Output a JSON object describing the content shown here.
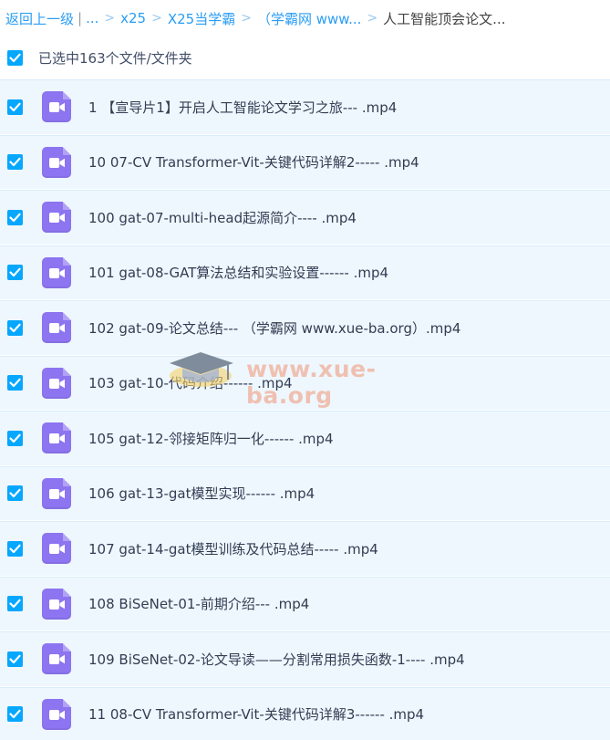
{
  "breadcrumb": {
    "back_label": "返回上一级",
    "divider": "|",
    "ellipsis": "...",
    "crumbs": [
      "x25",
      "X25当学霸",
      "（学霸网 www..."
    ],
    "current": "人工智能顶会论文..."
  },
  "selection": {
    "label": "已选中163个文件/文件夹"
  },
  "files": [
    {
      "name": "1 【宣导片1】开启人工智能论文学习之旅--- .mp4"
    },
    {
      "name": "10 07-CV Transformer-Vit-关键代码详解2----- .mp4"
    },
    {
      "name": "100 gat-07-multi-head起源简介---- .mp4"
    },
    {
      "name": "101 gat-08-GAT算法总结和实验设置------ .mp4"
    },
    {
      "name": "102 gat-09-论文总结--- （学霸网 www.xue-ba.org）.mp4"
    },
    {
      "name": "103 gat-10-代码介绍------ .mp4"
    },
    {
      "name": "105 gat-12-邻接矩阵归一化------ .mp4"
    },
    {
      "name": "106 gat-13-gat模型实现------ .mp4"
    },
    {
      "name": "107 gat-14-gat模型训练及代码总结----- .mp4"
    },
    {
      "name": "108 BiSeNet-01-前期介绍--- .mp4"
    },
    {
      "name": "109 BiSeNet-02-论文导读——分割常用损失函数-1---- .mp4"
    },
    {
      "name": "11 08-CV Transformer-Vit-关键代码详解3------ .mp4"
    }
  ],
  "watermark": {
    "text": "www.xue-ba.org"
  },
  "icons": {
    "checkbox": "checkbox-checked-icon",
    "file": "video-file-icon",
    "breadcrumb_sep": "chevron-right-icon",
    "watermark": "graduation-cap-icon"
  },
  "colors": {
    "accent": "#06a7ff",
    "link": "#2a9df4",
    "row_selected_bg": "#eef7fe",
    "video_icon": "#8d74f0",
    "watermark": "#f0b7a4"
  }
}
